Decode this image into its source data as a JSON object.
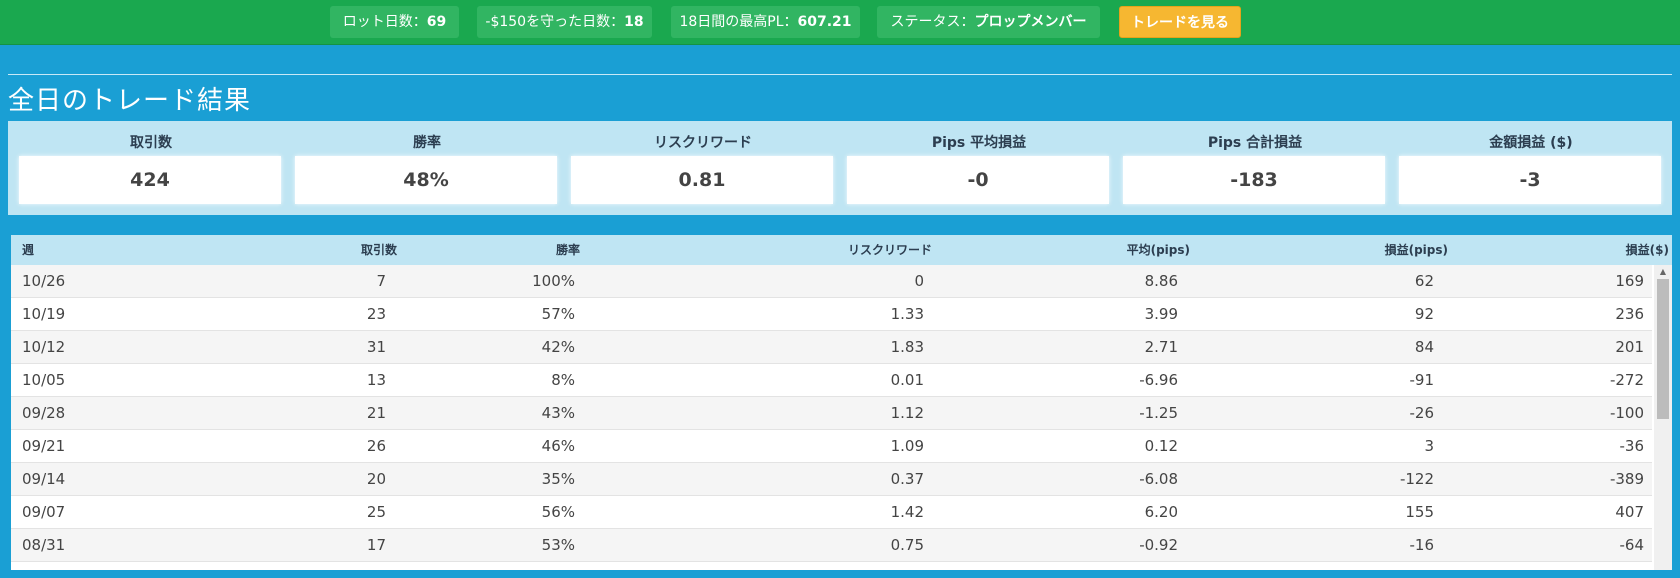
{
  "topbar": {
    "lot_days_label": "ロット日数：",
    "lot_days_value": "69",
    "kept_150_label": "-$150を守った日数：",
    "kept_150_value": "18",
    "max_pl_label": "18日間の最高PL：",
    "max_pl_value": "607.21",
    "status_label": "ステータス：",
    "status_value": "プロップメンバー",
    "view_trades_button": "トレードを見る"
  },
  "section": {
    "title": "全日のトレード結果"
  },
  "stats": [
    {
      "label": "取引数",
      "value": "424"
    },
    {
      "label": "勝率",
      "value": "48%"
    },
    {
      "label": "リスクリワード",
      "value": "0.81"
    },
    {
      "label": "Pips 平均損益",
      "value": "-0"
    },
    {
      "label": "Pips 合計損益",
      "value": "-183"
    },
    {
      "label": "金額損益 ($)",
      "value": "-3"
    }
  ],
  "table": {
    "headers": [
      "週",
      "取引数",
      "勝率",
      "リスクリワード",
      "平均(pips)",
      "損益(pips)",
      "損益($)"
    ],
    "rows": [
      [
        "10/26",
        "7",
        "100%",
        "0",
        "8.86",
        "62",
        "169"
      ],
      [
        "10/19",
        "23",
        "57%",
        "1.33",
        "3.99",
        "92",
        "236"
      ],
      [
        "10/12",
        "31",
        "42%",
        "1.83",
        "2.71",
        "84",
        "201"
      ],
      [
        "10/05",
        "13",
        "8%",
        "0.01",
        "-6.96",
        "-91",
        "-272"
      ],
      [
        "09/28",
        "21",
        "43%",
        "1.12",
        "-1.25",
        "-26",
        "-100"
      ],
      [
        "09/21",
        "26",
        "46%",
        "1.09",
        "0.12",
        "3",
        "-36"
      ],
      [
        "09/14",
        "20",
        "35%",
        "0.37",
        "-6.08",
        "-122",
        "-389"
      ],
      [
        "09/07",
        "25",
        "56%",
        "1.42",
        "6.20",
        "155",
        "407"
      ],
      [
        "08/31",
        "17",
        "53%",
        "0.75",
        "-0.92",
        "-16",
        "-64"
      ]
    ]
  },
  "colors": {
    "topbar_green": "#1aa84f",
    "page_blue": "#1a9fd4",
    "panel_light_blue": "#bfe5f3",
    "button_orange": "#f6b731"
  }
}
